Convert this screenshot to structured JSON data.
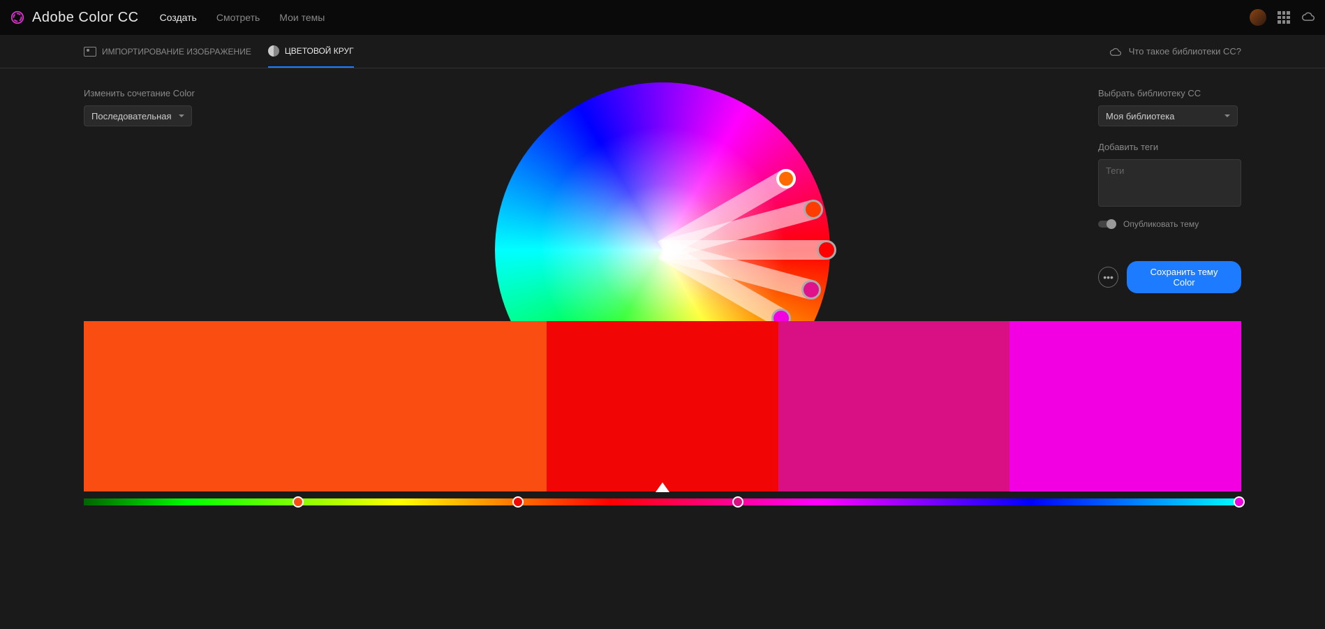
{
  "header": {
    "logo_text": "Adobe Color CC",
    "nav_create": "Создать",
    "nav_explore": "Смотреть",
    "nav_mythemes": "Мои темы"
  },
  "subheader": {
    "import_image": "ИМПОРТИРОВАНИЕ ИЗОБРАЖЕНИЕ",
    "color_wheel": "ЦВЕТОВОЙ КРУГ",
    "cc_help": "Что такое библиотеки CC?"
  },
  "left": {
    "rule_label": "Изменить сочетание Color",
    "rule_selected": "Последовательная"
  },
  "right": {
    "lib_label": "Выбрать библиотеку CC",
    "lib_selected": "Моя библиотека",
    "tags_label": "Добавить теги",
    "tags_placeholder": "Теги",
    "publish_label": "Опубликовать тему",
    "save_label": "Сохранить тему Color"
  },
  "palette": {
    "swatches": [
      "#f94d12",
      "#f94d12",
      "#f20505",
      "#d90f84",
      "#f200e2"
    ],
    "base_index": 2
  },
  "wheel_markers": [
    {
      "angle": -30,
      "radius": 0.85,
      "color": "#ff6a00",
      "base": true
    },
    {
      "angle": -15,
      "radius": 0.93,
      "color": "#ff3c00",
      "base": false
    },
    {
      "angle": 0,
      "radius": 0.98,
      "color": "#ff0000",
      "base": false
    },
    {
      "angle": 15,
      "radius": 0.92,
      "color": "#e0118a",
      "base": false
    },
    {
      "angle": 30,
      "radius": 0.82,
      "color": "#f200e2",
      "base": false
    }
  ],
  "hue_dots": [
    {
      "pos": 0.185,
      "color": "#f94d12"
    },
    {
      "pos": 0.375,
      "color": "#f20505"
    },
    {
      "pos": 0.565,
      "color": "#d90f84"
    },
    {
      "pos": 0.998,
      "color": "#f200e2"
    }
  ]
}
